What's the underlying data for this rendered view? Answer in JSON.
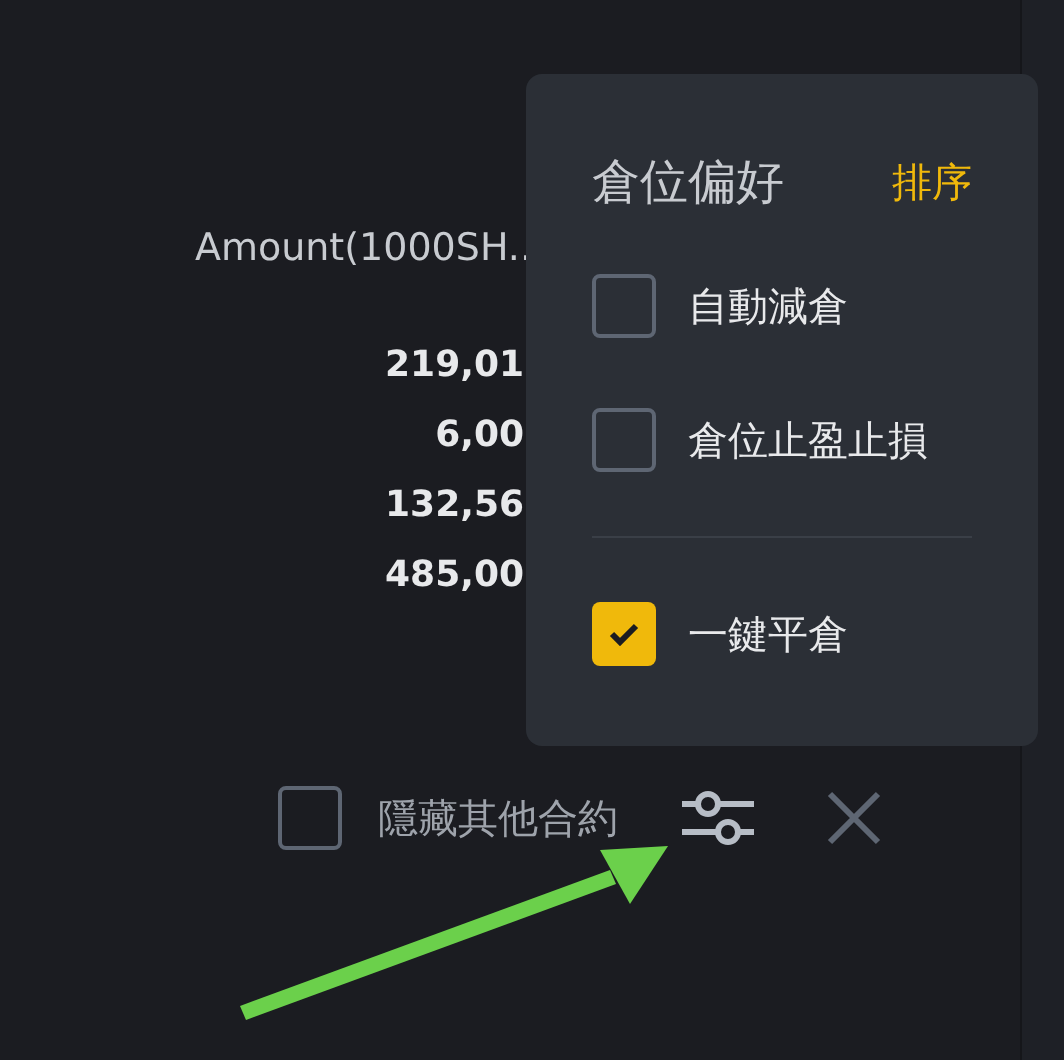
{
  "table": {
    "column_header": "Amount(1000SH..",
    "rows": [
      "219,01",
      "6,00",
      "132,56",
      "485,00"
    ]
  },
  "popup": {
    "title": "倉位偏好",
    "sort_link": "排序",
    "sections": [
      [
        {
          "label": "自動減倉",
          "checked": false
        },
        {
          "label": "倉位止盈止損",
          "checked": false
        }
      ],
      [
        {
          "label": "一鍵平倉",
          "checked": true
        }
      ]
    ]
  },
  "footer": {
    "hide_other": {
      "label": "隱藏其他合約",
      "checked": false
    }
  }
}
